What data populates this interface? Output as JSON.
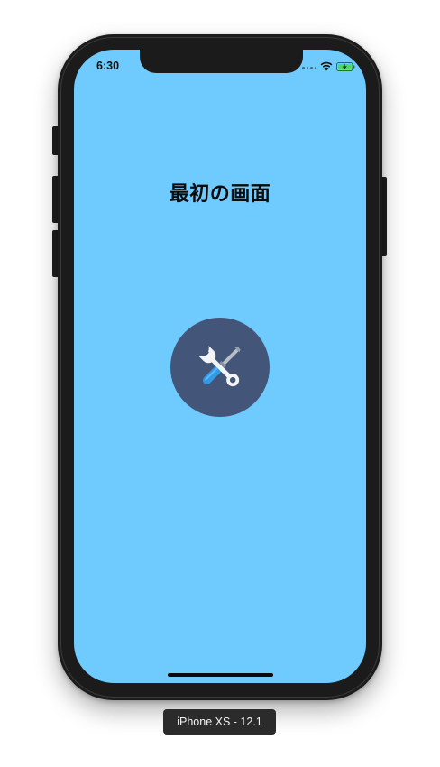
{
  "status_bar": {
    "time": "6:30",
    "icons": [
      "signal-dots-icon",
      "wifi-icon",
      "battery-charging-icon"
    ]
  },
  "screen": {
    "background_color": "#6fcbfe",
    "title": "最初の画面",
    "tool_button": {
      "icon": "wrench-screwdriver-icon",
      "background_color": "#44557a"
    }
  },
  "simulator": {
    "device_label": "iPhone XS - 12.1"
  }
}
